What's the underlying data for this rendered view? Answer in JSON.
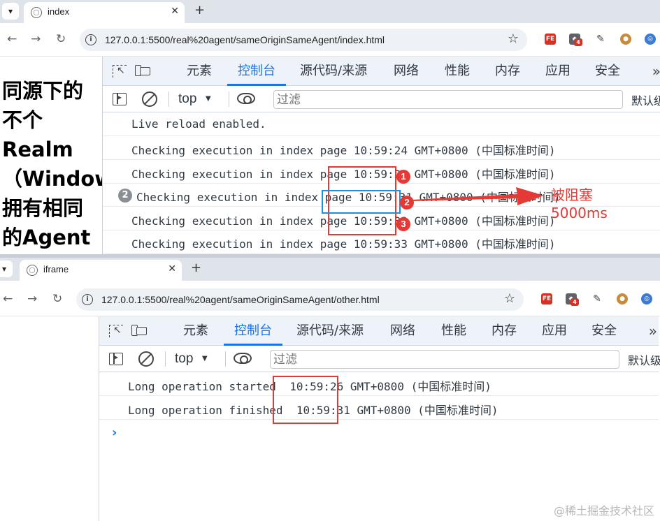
{
  "window1": {
    "tab_title": "index",
    "url": "127.0.0.1:5500/real%20agent/sameOriginSameAgent/index.html",
    "page_heading": "同源下的\n不个\nRealm\n（Window\n拥有相同\n的Agent",
    "console_lines": [
      "Live reload enabled.",
      "Checking execution in index page 10:59:24 GMT+0800 (中国标准时间)",
      "Checking execution in index page 10:59:25 GMT+0800 (中国标准时间)",
      "Checking execution in index page 10:59:31 GMT+0800 (中国标准时间)",
      "Checking execution in index page 10:59:32 GMT+0800 (中国标准时间)",
      "Checking execution in index page 10:59:33 GMT+0800 (中国标准时间)"
    ],
    "repeat_count": "2"
  },
  "window2": {
    "tab_title": "iframe",
    "url": "127.0.0.1:5500/real%20agent/sameOriginSameAgent/other.html",
    "console_lines": [
      "Long operation started  10:59:26 GMT+0800 (中国标准时间)",
      "Long operation finished  10:59:31 GMT+0800 (中国标准时间)"
    ],
    "prompt": "›"
  },
  "devtools": {
    "tabs": [
      "元素",
      "控制台",
      "源代码/来源",
      "网络",
      "性能",
      "内存",
      "应用",
      "安全"
    ],
    "active_tab": "控制台",
    "more": "»",
    "context": "top",
    "filter_placeholder": "过滤",
    "levels_label": "默认级"
  },
  "browser": {
    "tablist_icon": "chevron-down-icon",
    "new_tab": "+",
    "close_tab": "✕",
    "back": "←",
    "forward": "→",
    "reload": "↻",
    "star": "☆",
    "extension_badge": "4"
  },
  "annotations": {
    "marker_1": "1",
    "marker_2": "2",
    "marker_3": "3",
    "blocked_label": "被阻塞\n5000ms",
    "colors": {
      "red": "#e53935",
      "blue": "#1f8fd6",
      "accent": "#1a73e8"
    }
  },
  "watermark": "@稀土掘金技术社区"
}
